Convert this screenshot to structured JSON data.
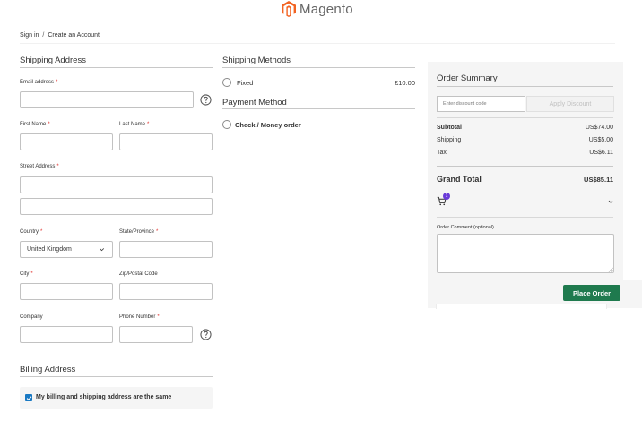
{
  "logo": {
    "text": "Magento",
    "color": "#f26322"
  },
  "auth": {
    "sign_in": "Sign in",
    "separator": "/",
    "create_account": "Create an Account"
  },
  "shipping_address": {
    "title": "Shipping Address",
    "email_label": "Email address",
    "first_name_label": "First Name",
    "last_name_label": "Last Name",
    "street_label": "Street Address",
    "country_label": "Country",
    "country_value": "United Kingdom",
    "state_label": "State/Province",
    "city_label": "City",
    "zip_label": "Zip/Postal Code",
    "company_label": "Company",
    "phone_label": "Phone Number",
    "required_mark": "*"
  },
  "shipping_methods": {
    "title": "Shipping Methods",
    "option_label": "Fixed",
    "option_price": "£10.00"
  },
  "payment_method": {
    "title": "Payment Method",
    "option_label": "Check / Money order"
  },
  "billing_address": {
    "title": "Billing Address",
    "same_as_shipping": "My billing and shipping address are the same"
  },
  "order_summary": {
    "title": "Order Summary",
    "discount_placeholder": "Enter discount code",
    "apply_discount": "Apply Discount",
    "subtotal_label": "Subtotal",
    "subtotal_value": "US$74.00",
    "shipping_label": "Shipping",
    "shipping_value": "US$5.00",
    "tax_label": "Tax",
    "tax_value": "US$6.11",
    "grand_total_label": "Grand Total",
    "grand_total_value": "US$85.11",
    "cart_count": "1",
    "comment_label": "Order Comment (optional)",
    "place_order": "Place Order"
  },
  "colors": {
    "accent_blue": "#1979c3",
    "place_order_green": "#1f7a4e",
    "required_red": "#e02b27",
    "badge_purple": "#6a3bd8"
  },
  "icons": [
    "magento-logo-icon",
    "help-icon",
    "chevron-down-icon",
    "cart-icon",
    "checkmark-icon",
    "radio-icon"
  ]
}
